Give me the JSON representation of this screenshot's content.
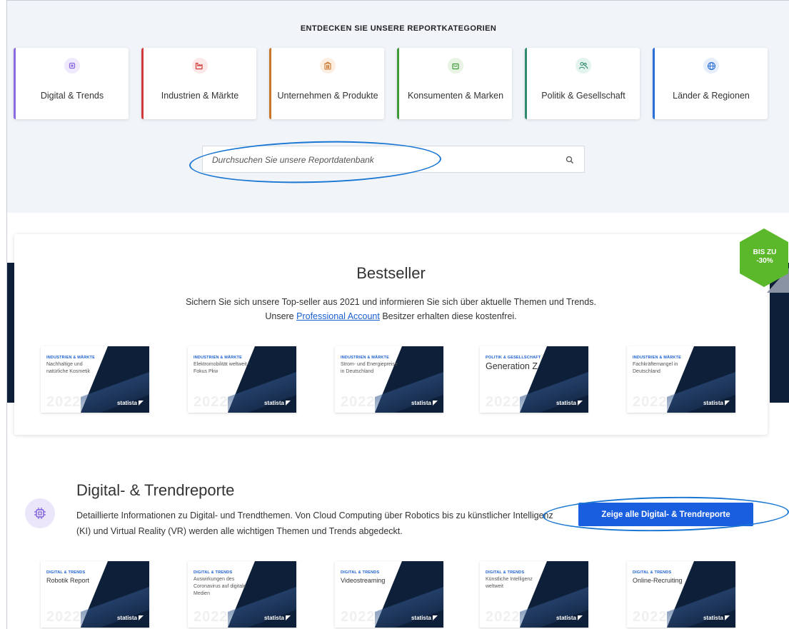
{
  "header": {
    "title": "ENTDECKEN SIE UNSERE REPORTKATEGORIEN"
  },
  "categories": [
    {
      "label": "Digital & Trends",
      "color": "#8a6be0",
      "icon": "chip-icon"
    },
    {
      "label": "Industrien & Märkte",
      "color": "#d23b3b",
      "icon": "factory-icon"
    },
    {
      "label": "Unternehmen & Produkte",
      "color": "#c8762a",
      "icon": "building-icon"
    },
    {
      "label": "Konsumenten & Marken",
      "color": "#3f9a3a",
      "icon": "shopping-bag-icon"
    },
    {
      "label": "Politik & Gesellschaft",
      "color": "#2f8a6e",
      "icon": "people-icon"
    },
    {
      "label": "Länder & Regionen",
      "color": "#2a6fd6",
      "icon": "globe-icon"
    }
  ],
  "search": {
    "placeholder": "Durchsuchen Sie unsere Reportdatenbank"
  },
  "bestseller": {
    "title": "Bestseller",
    "subtitle_line1": "Sichern Sie sich unsere Top-seller aus 2021 und informieren Sie sich über aktuelle Themen und Trends.",
    "subtitle_pre": "Unsere ",
    "subtitle_link": "Professional Account",
    "subtitle_post": " Besitzer erhalten diese kostenfrei.",
    "badge": "BIS ZU -30%",
    "badge_line1": "BIS ZU",
    "badge_line2": "-30%",
    "reports": [
      {
        "category": "INDUSTRIEN & MÄRKTE",
        "title": "Nachhaltige und natürliche Kosmetik",
        "year": "2022",
        "logo": "statista"
      },
      {
        "category": "INDUSTRIEN & MÄRKTE",
        "title": "Elektromobilität weltweit - Fokus Pkw",
        "year": "2022",
        "logo": "statista"
      },
      {
        "category": "INDUSTRIEN & MÄRKTE",
        "title": "Strom- und Energiepreise in Deutschland",
        "year": "2022",
        "logo": "statista"
      },
      {
        "category": "POLITIK & GESELLSCHAFT",
        "title": "Generation Z",
        "year": "2022",
        "logo": "statista"
      },
      {
        "category": "INDUSTRIEN & MÄRKTE",
        "title": "Fachkräftemangel in Deutschland",
        "year": "2022",
        "logo": "statista"
      }
    ]
  },
  "digital": {
    "title": "Digital- & Trendreporte",
    "description": "Detaillierte Informationen zu Digital- und Trendthemen. Von Cloud Computing über Robotics bis zu künstlicher Intelligenz (KI) und Virtual Reality (VR) werden alle wichtigen Themen und Trends abgedeckt.",
    "button_label": "Zeige alle Digital- & Trendreporte",
    "reports": [
      {
        "category": "DIGITAL & TRENDS",
        "title": "Robotik Report",
        "year": "2022",
        "logo": "statista"
      },
      {
        "category": "DIGITAL & TRENDS",
        "title": "Auswirkungen des Coronavirus auf digitale Medien",
        "year": "2022",
        "logo": "statista"
      },
      {
        "category": "DIGITAL & TRENDS",
        "title": "Videostreaming",
        "year": "2022",
        "logo": "statista"
      },
      {
        "category": "DIGITAL & TRENDS",
        "title": "Künstliche Intelligenz weltweit",
        "year": "2022",
        "logo": "statista"
      },
      {
        "category": "DIGITAL & TRENDS",
        "title": "Online-Recruiting",
        "year": "2022",
        "logo": "statista"
      }
    ]
  },
  "colors": {
    "accent": "#1a5ee0",
    "navy": "#0e1f3a",
    "badge": "#5bb82a",
    "page_bg_top": "#f1f5fa",
    "annotation": "#1976d2"
  }
}
